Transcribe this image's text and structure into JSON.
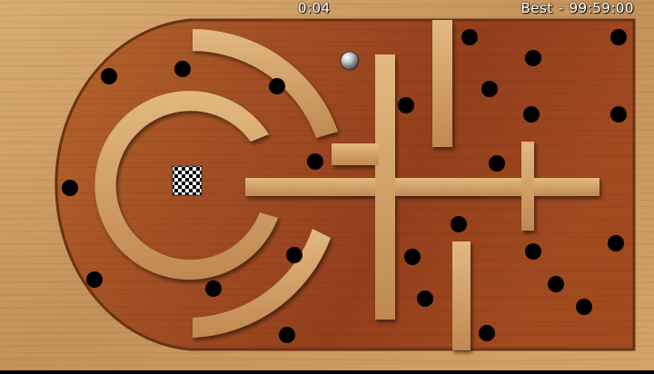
{
  "hud": {
    "timer": "0:04",
    "best_label": "Best",
    "best_separator": "-",
    "best_time": "99:59:00"
  },
  "colors": {
    "frame_wood": "#c99a5c",
    "floor_wood": "#9c4a22",
    "hole": "#000000",
    "ball": "#cfcfcf",
    "goal_dark": "#000000",
    "goal_light": "#ffffff"
  },
  "icons": {
    "ball": "steel-ball-icon",
    "goal": "checkered-goal-icon",
    "hole": "hole-icon"
  }
}
